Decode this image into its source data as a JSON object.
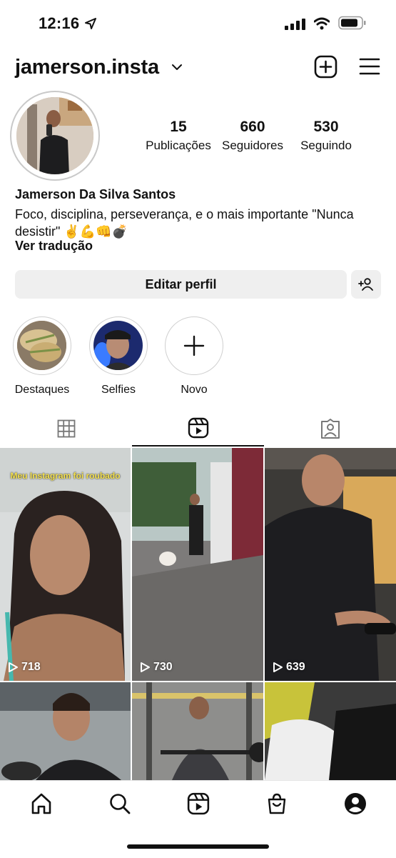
{
  "status_bar": {
    "time": "12:16"
  },
  "header": {
    "username": "jamerson.insta"
  },
  "profile": {
    "stats": [
      {
        "value": "15",
        "label": "Publicações"
      },
      {
        "value": "660",
        "label": "Seguidores"
      },
      {
        "value": "530",
        "label": "Seguindo"
      }
    ],
    "full_name": "Jamerson Da Silva Santos",
    "bio": "Foco, disciplina, perseverança, e o mais importante \"Nunca desistir\" ✌️💪👊💣",
    "translate_label": "Ver tradução",
    "edit_button": "Editar perfil"
  },
  "highlights": [
    {
      "label": "Destaques"
    },
    {
      "label": "Selfies"
    },
    {
      "label": "Novo"
    }
  ],
  "tabs": [
    {
      "name": "grid",
      "active": false
    },
    {
      "name": "reels",
      "active": true
    },
    {
      "name": "tagged",
      "active": false
    }
  ],
  "reels": [
    {
      "views": "718",
      "caption": "Meu Instagram foi roubado"
    },
    {
      "views": "730"
    },
    {
      "views": "639"
    },
    {
      "views": ""
    },
    {
      "views": ""
    },
    {
      "views": ""
    }
  ],
  "bottom_nav": [
    "home-icon",
    "search-icon",
    "reels-icon",
    "shop-icon",
    "profile-icon"
  ]
}
